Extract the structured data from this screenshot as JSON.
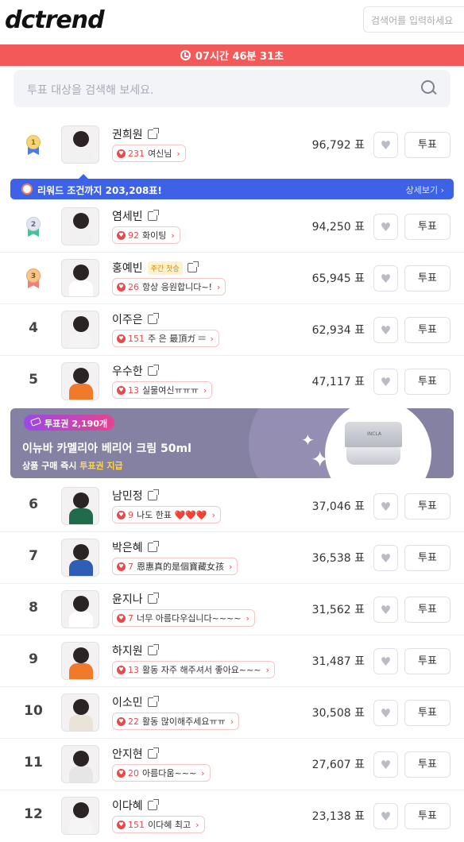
{
  "header": {
    "logo": "dctrend",
    "search_placeholder": "검색어를 입력하세요"
  },
  "timer": {
    "text": "07시간 46분 31초"
  },
  "vote_search": {
    "placeholder": "투표 대상을 검색해 보세요."
  },
  "reward": {
    "text": "리워드 조건까지 203,208표!",
    "link": "상세보기 ›"
  },
  "banner": {
    "ticket_label": "투표권 2,190개",
    "title": "이뉴바 카멜리아 베리어 크림 50ml",
    "sub_prefix": "상품 구매 즉시 ",
    "sub_highlight": "투표권 지급",
    "product_brand": "INCLA"
  },
  "vote_button_label": "투표",
  "entries": [
    {
      "rank": "1",
      "medal": "gold",
      "name": "권희원",
      "count": "231",
      "message": "여신님",
      "votes": "96,792 표",
      "shirt": "#f1f1f1"
    },
    {
      "rank": "2",
      "medal": "silver",
      "name": "염세빈",
      "count": "92",
      "message": "화이팅",
      "votes": "94,250 표",
      "shirt": "#f1f1f1"
    },
    {
      "rank": "3",
      "medal": "bronze",
      "name": "홍예빈",
      "badge": "주간 첫승",
      "count": "26",
      "message": "항상 응원합니다~!",
      "votes": "65,945 표",
      "shirt": "#ffffff"
    },
    {
      "rank": "4",
      "name": "이주은",
      "count": "151",
      "message": "주 은 最頂ガ 𝄘",
      "votes": "62,934 표",
      "shirt": "#f4f4f4"
    },
    {
      "rank": "5",
      "name": "우수한",
      "count": "13",
      "message": "실물여신ㅠㅠㅠ",
      "votes": "47,117 표",
      "shirt": "#f07a2a"
    },
    {
      "rank": "6",
      "name": "남민정",
      "count": "9",
      "message": "나도 한표 ❤️❤️❤️",
      "votes": "37,046 표",
      "shirt": "#1f6b4a"
    },
    {
      "rank": "7",
      "name": "박은혜",
      "count": "7",
      "message": "恩惠真的是個寶藏女孩",
      "votes": "36,538 표",
      "shirt": "#2f5fb5"
    },
    {
      "rank": "8",
      "name": "윤지나",
      "count": "7",
      "message": "너무 아름다우십니다~~~~",
      "votes": "31,562 표",
      "shirt": "#ffffff"
    },
    {
      "rank": "9",
      "name": "하지원",
      "count": "13",
      "message": "활동 자주 해주셔서 좋아요~~~",
      "votes": "31,487 표",
      "shirt": "#f07a2a"
    },
    {
      "rank": "10",
      "name": "이소민",
      "count": "22",
      "message": "활동 많이해주세요ㅠㅠ",
      "votes": "30,508 표",
      "shirt": "#e9e3d8"
    },
    {
      "rank": "11",
      "name": "안지현",
      "count": "20",
      "message": "아름다움~~~",
      "votes": "27,607 표",
      "shirt": "#e6e6e6"
    },
    {
      "rank": "12",
      "name": "이다혜",
      "count": "151",
      "message": "이다혜 최고",
      "votes": "23,138 표",
      "shirt": "#f5f5f5"
    }
  ]
}
